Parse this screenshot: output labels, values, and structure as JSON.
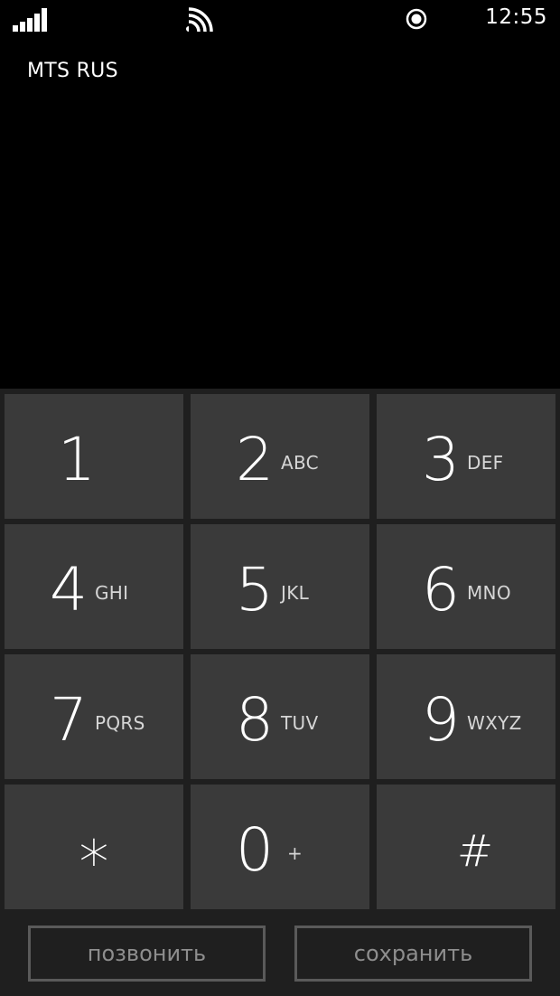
{
  "status_bar": {
    "time": "12:55",
    "icons": [
      "signal-strength-icon",
      "wifi-icon",
      "location-icon"
    ]
  },
  "carrier": "MTS RUS",
  "keypad": {
    "keys": [
      {
        "digit": "1",
        "letters": ""
      },
      {
        "digit": "2",
        "letters": "ABC"
      },
      {
        "digit": "3",
        "letters": "DEF"
      },
      {
        "digit": "4",
        "letters": "GHI"
      },
      {
        "digit": "5",
        "letters": "JKL"
      },
      {
        "digit": "6",
        "letters": "MNO"
      },
      {
        "digit": "7",
        "letters": "PQRS"
      },
      {
        "digit": "8",
        "letters": "TUV"
      },
      {
        "digit": "9",
        "letters": "WXYZ"
      },
      {
        "digit": "*",
        "letters": ""
      },
      {
        "digit": "0",
        "letters": "+"
      },
      {
        "digit": "#",
        "letters": ""
      }
    ]
  },
  "actions": {
    "call_label": "позвонить",
    "save_label": "сохранить"
  },
  "colors": {
    "background": "#000000",
    "keypad_bg": "#1f1f1f",
    "key_bg": "#3a3a3a",
    "button_border": "#5a5a5a",
    "button_text": "#8e8e8e"
  }
}
